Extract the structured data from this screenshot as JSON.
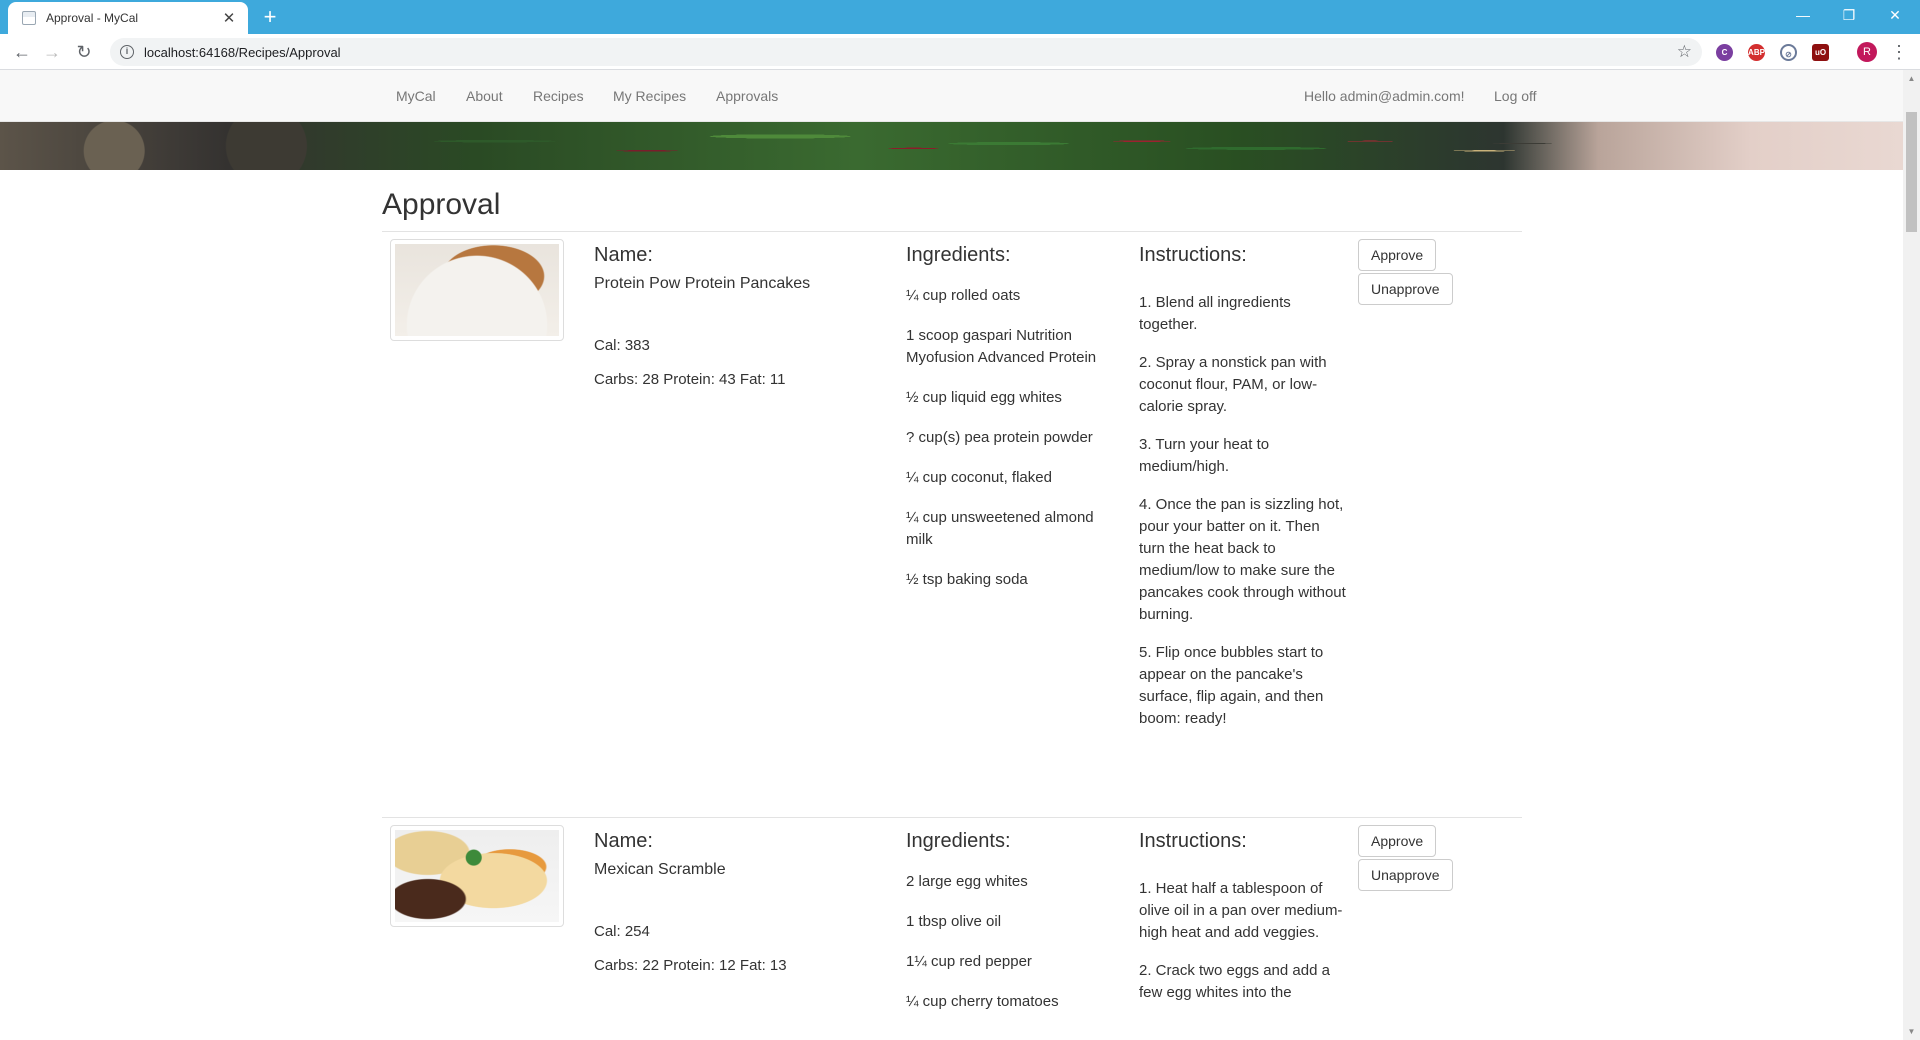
{
  "browser": {
    "tab_title": "Approval - MyCal",
    "url": "localhost:64168/Recipes/Approval",
    "profile_initial": "R"
  },
  "nav": {
    "links": [
      "MyCal",
      "About",
      "Recipes",
      "My Recipes",
      "Approvals"
    ],
    "greeting": "Hello admin@admin.com!",
    "logoff": "Log off"
  },
  "page": {
    "title": "Approval"
  },
  "labels": {
    "name": "Name:",
    "ingredients": "Ingredients:",
    "instructions": "Instructions:",
    "approve": "Approve",
    "unapprove": "Unapprove"
  },
  "recipes": [
    {
      "name": "Protein Pow Protein Pancakes",
      "cal": "Cal: 383",
      "macros": "Carbs: 28 Protein: 43 Fat: 11",
      "ingredients": [
        "¼ cup rolled oats",
        "1 scoop gaspari Nutrition Myofusion Advanced Protein",
        "½ cup liquid egg whites",
        "? cup(s) pea protein powder",
        "¼ cup coconut, flaked",
        "¼ cup unsweetened almond milk",
        "½ tsp baking soda"
      ],
      "instructions": [
        "1. Blend all ingredients together.",
        "2. Spray a nonstick pan with coconut flour, PAM, or low-calorie spray.",
        "3. Turn your heat to medium/high.",
        "4. Once the pan is sizzling hot, pour your batter on it. Then turn the heat back to medium/low to make sure the pancakes cook through without burning.",
        "5. Flip once bubbles start to appear on the pancake's surface, flip again, and then boom: ready!"
      ]
    },
    {
      "name": "Mexican Scramble",
      "cal": "Cal: 254",
      "macros": "Carbs: 22 Protein: 12 Fat: 13",
      "ingredients": [
        "2 large egg whites",
        "1 tbsp olive oil",
        "1¼ cup red pepper",
        "¼ cup cherry tomatoes"
      ],
      "instructions": [
        "1. Heat half a tablespoon of olive oil in a pan over medium-high heat and add veggies.",
        "2. Crack two eggs and add a few egg whites into the"
      ]
    }
  ]
}
